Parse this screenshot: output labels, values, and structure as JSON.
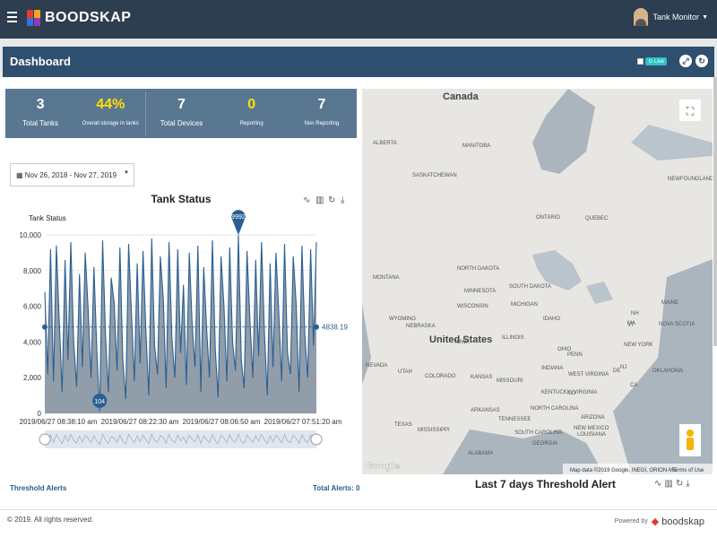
{
  "app": {
    "name": "BOODSKAP",
    "user": "Tank Monitor"
  },
  "dashboard": {
    "title": "Dashboard",
    "live_label": "Live"
  },
  "stats": [
    {
      "value": "3",
      "label": "Total Tanks"
    },
    {
      "value": "44%",
      "label": "Overall storage in tanks"
    },
    {
      "value": "7",
      "label": "Total Devices"
    },
    {
      "value": "0",
      "label": "Reporting"
    },
    {
      "value": "7",
      "label": "Non Reporting"
    }
  ],
  "date_range": "Nov 26, 2018 - Nov 27, 2019",
  "threshold": {
    "title": "Threshold Alerts",
    "total": "Total Alerts: 0"
  },
  "seven_day_title": "Last 7 days Threshold Alert",
  "map": {
    "countries": [
      "Canada",
      "United States"
    ],
    "regions": [
      "ALBERTA",
      "MANITOBA",
      "SASKATCHEWAN",
      "ONTARIO",
      "QUEBEC",
      "NEWFOUNDLAND AND LABRADOR",
      "NORTH DAKOTA",
      "MONTANA",
      "MINNESOTA",
      "SOUTH DAKOTA",
      "WISCONSIN",
      "MICHIGAN",
      "IDAHO",
      "WYOMING",
      "NEBRASKA",
      "IOWA",
      "ILLINOIS",
      "OHIO",
      "PENN",
      "NEW YORK",
      "VT",
      "NH",
      "MAINE",
      "NOVA SCOTIA",
      "MA",
      "NEVADA",
      "UTAH",
      "COLORADO",
      "KANSAS",
      "MISSOURI",
      "INDIANA",
      "WEST VIRGINIA",
      "VIRGINIA",
      "KENTUCKY",
      "MD",
      "DE",
      "NJ",
      "CA",
      "OKLAHOMA",
      "ARKANSAS",
      "TENNESSEE",
      "NORTH CAROLINA",
      "ARIZONA",
      "NEW MEXICO",
      "TEXAS",
      "MISSISSIPPI",
      "ALABAMA",
      "SOUTH CAROLINA",
      "GEORGIA",
      "LOUISIANA"
    ],
    "attribution": "Map data ©2019 Google, INEGI, ORION-ME",
    "terms": "Terms of Use",
    "google": "Google"
  },
  "footer": {
    "copyright": "© 2019. All rights reserved.",
    "powered": "Powered by",
    "brand": "boodskap"
  },
  "chart_data": {
    "type": "area",
    "title": "Tank Status",
    "ylabel": "Tank Status",
    "ylim": [
      0,
      10000
    ],
    "yticks": [
      "0",
      "2,000",
      "4,000",
      "6,000",
      "8,000",
      "10,000"
    ],
    "xticks": [
      "2019/06/27 08:38:10 am",
      "2019/06/27 08:22:30 am",
      "2019/06/27 08:06:50 am",
      "2019/06/27 07:51:20 am"
    ],
    "max_label": "9992",
    "min_label": "104",
    "current_label": "4838.19",
    "max_value": 9992,
    "min_value": 104,
    "current_value": 4838.19,
    "values": [
      6800,
      2200,
      9200,
      1800,
      9400,
      5200,
      1200,
      8600,
      3000,
      9600,
      4000,
      1500,
      7800,
      2600,
      9000,
      5800,
      2000,
      8200,
      3600,
      104,
      9700,
      4400,
      1200,
      7600,
      6200,
      2400,
      9300,
      3000,
      800,
      9500,
      5600,
      1800,
      8400,
      2800,
      9100,
      4600,
      1000,
      9800,
      3800,
      2200,
      8800,
      6400,
      1400,
      9600,
      4200,
      2000,
      9200,
      3400,
      7200,
      1600,
      9000,
      5000,
      2600,
      9400,
      1200,
      8200,
      4800,
      2000,
      9700,
      3600,
      900,
      8800,
      6000,
      1800,
      9300,
      4000,
      2400,
      9992,
      3000,
      1400,
      9100,
      5200,
      2000,
      8600,
      3200,
      9600,
      4600,
      1000,
      8400,
      2600,
      9000,
      5600,
      1800,
      9500,
      3400,
      2200,
      8800,
      6200,
      1200,
      9400,
      4400,
      2000,
      9200,
      3800,
      9600
    ]
  }
}
